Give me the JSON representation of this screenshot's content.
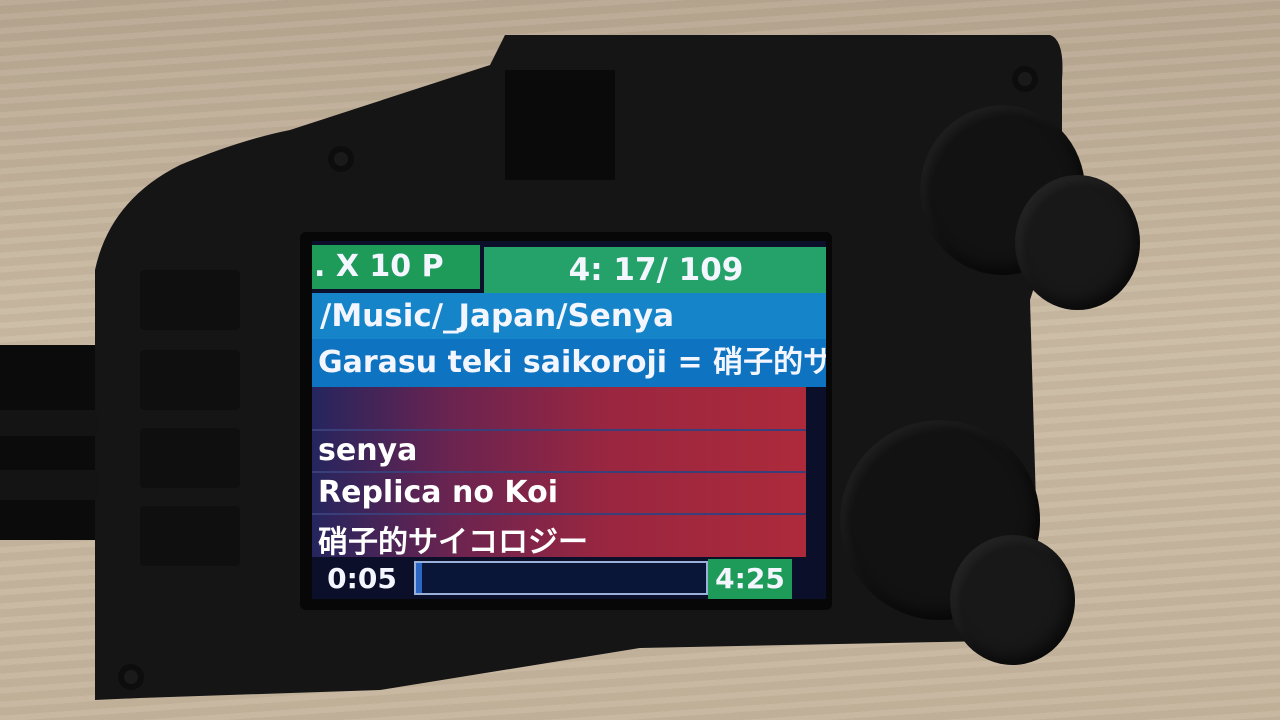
{
  "screen": {
    "header": {
      "mode_text": ". X 10 P",
      "track_counter": "4:  17/ 109"
    },
    "folder_path": "/Music/_Japan/Senya",
    "file_title": "Garasu teki saikoroji = 硝子的サイ",
    "tags": {
      "line1": "",
      "artist": "senya",
      "album": "Replica no Koi",
      "title": "硝子的サイコロジー"
    },
    "playback": {
      "elapsed": "0:05",
      "total": "4:25",
      "progress_fraction": 0.019
    }
  },
  "colors": {
    "header_green": "#1f9b59",
    "path_blue": "#1684c8",
    "title_blue": "#0e73c0",
    "info_red": "#ad2a3b",
    "progress_bg": "#0a1638"
  }
}
